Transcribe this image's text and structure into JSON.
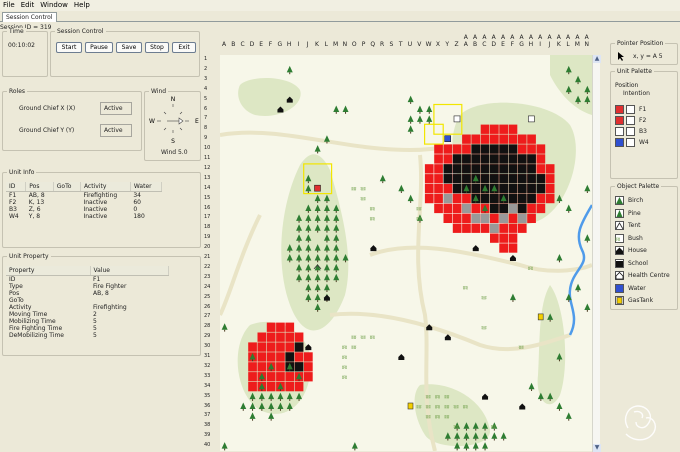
{
  "menu": [
    "File",
    "Edit",
    "Window",
    "Help"
  ],
  "tab": "Session Control",
  "session_id": "Session ID = 319",
  "time": {
    "title": "Time",
    "value": "00:10:02"
  },
  "session_control": {
    "title": "Session Control",
    "buttons": [
      "Start",
      "Pause",
      "Save",
      "Stop",
      "Exit"
    ]
  },
  "roles": {
    "title": "Roles",
    "rows": [
      {
        "label": "Ground Chief X  (X)",
        "status": "Active"
      },
      {
        "label": "Ground Chief Y  (Y)",
        "status": "Active"
      }
    ]
  },
  "wind": {
    "title": "Wind",
    "n": "N",
    "s": "S",
    "e": "E",
    "w": "W",
    "value": "Wind 5.0"
  },
  "unit_info": {
    "title": "Unit Info",
    "headers": [
      "ID",
      "Pos",
      "GoTo",
      "Activity",
      "Water"
    ],
    "rows": [
      [
        "F1",
        "AB, 8",
        "",
        "Firefighting",
        "34"
      ],
      [
        "F2",
        "K, 13",
        "",
        "Inactive",
        "60"
      ],
      [
        "B3",
        "Z, 6",
        "",
        "Inactive",
        "0"
      ],
      [
        "W4",
        "Y, 8",
        "",
        "Inactive",
        "180"
      ]
    ]
  },
  "unit_property": {
    "title": "Unit Property",
    "headers": [
      "Property",
      "Value"
    ],
    "rows": [
      [
        "ID",
        "F1"
      ],
      [
        "Type",
        "Fire Fighter"
      ],
      [
        "Pos",
        "AB, 8"
      ],
      [
        "GoTo",
        ""
      ],
      [
        "Activity",
        "Firefighting"
      ],
      [
        "Moving Time",
        "2"
      ],
      [
        "Mobilizing Time",
        "5"
      ],
      [
        "Fire Fighting Time",
        "5"
      ],
      [
        "DeMobilizing Time",
        "5"
      ]
    ]
  },
  "columns": [
    "A",
    "B",
    "C",
    "D",
    "E",
    "F",
    "G",
    "H",
    "I",
    "J",
    "K",
    "L",
    "M",
    "N",
    "O",
    "P",
    "Q",
    "R",
    "S",
    "T",
    "U",
    "V",
    "W",
    "X",
    "Y",
    "Z",
    "A|A",
    "A|B",
    "A|C",
    "A|D",
    "A|E",
    "A|F",
    "A|G",
    "A|H",
    "A|I",
    "A|J",
    "A|K",
    "A|L",
    "A|M",
    "A|N"
  ],
  "rows": [
    "1",
    "2",
    "3",
    "4",
    "5",
    "6",
    "7",
    "8",
    "9",
    "10",
    "11",
    "12",
    "13",
    "14",
    "15",
    "16",
    "17",
    "18",
    "19",
    "20",
    "21",
    "22",
    "23",
    "24",
    "25",
    "26",
    "27",
    "28",
    "29",
    "30",
    "31",
    "32",
    "33",
    "34",
    "35",
    "36",
    "37",
    "38",
    "39",
    "40"
  ],
  "pointer": {
    "title": "Pointer Position",
    "value": "x, y =  A 5"
  },
  "unit_palette": {
    "title": "Unit Palette",
    "header1": "Position",
    "header2": "Intention",
    "items": [
      "F1",
      "F2",
      "B3",
      "W4"
    ]
  },
  "object_palette": {
    "title": "Object Palette",
    "items": [
      "Birch",
      "Pine",
      "Tent",
      "Bush",
      "House",
      "School",
      "Health Centre",
      "Water",
      "GasTank"
    ]
  },
  "colors": {
    "fire": "#ee1c1c",
    "burnt": "#111111",
    "smoke": "#999999",
    "tree": "#2e7d32",
    "map_bg": "#f7f7e9",
    "selection": "#f2e600"
  }
}
